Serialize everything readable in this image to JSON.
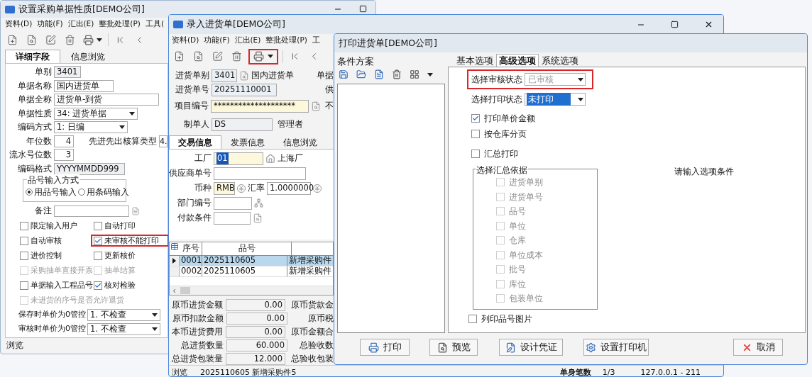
{
  "back_window": {
    "title": "设置采购单据性质[DEMO公司]",
    "menu": [
      "资料(D)",
      "功能(F)",
      "汇出(E)",
      "整批处理(P)",
      "工具("
    ],
    "tabs": [
      {
        "label": "详细字段",
        "selected": true
      },
      {
        "label": "信息浏览",
        "selected": false
      }
    ],
    "fields": [
      {
        "label": "单别",
        "value": "3401",
        "kind": "readonly"
      },
      {
        "label": "单据名称",
        "value": "国内进货单",
        "kind": "text"
      },
      {
        "label": "单据全称",
        "value": "进货单-到货",
        "kind": "text"
      },
      {
        "label": "单据性质",
        "value": "34: 进货单据",
        "kind": "select"
      },
      {
        "label": "编码方式",
        "value": "1: 日编",
        "kind": "select"
      },
      {
        "label": "年位数",
        "value": "4",
        "kind": "number",
        "side_label": "先进先出核算类型",
        "side_value": "4."
      },
      {
        "label": "流水号位数",
        "value": "3",
        "kind": "number"
      },
      {
        "label": "编码格式",
        "value": "YYYYMMDD999",
        "kind": "readonly"
      }
    ],
    "input_mode": {
      "title": "品号输入方式",
      "options": [
        {
          "label": "用品号输入",
          "selected": true
        },
        {
          "label": "用条码输入",
          "selected": false
        }
      ]
    },
    "remark": {
      "label": "备注"
    },
    "checkboxes": [
      {
        "label": "限定输入用户",
        "checked": false,
        "disabled": false,
        "highlighted": false
      },
      {
        "label": "自动打印",
        "checked": false,
        "disabled": false,
        "highlighted": false
      },
      {
        "label": "自动审核",
        "checked": false,
        "disabled": false,
        "highlighted": false
      },
      {
        "label": "未审核不能打印",
        "checked": true,
        "disabled": false,
        "highlighted": true
      },
      {
        "label": "进价控制",
        "checked": false,
        "disabled": false,
        "highlighted": false
      },
      {
        "label": "更新核价",
        "checked": false,
        "disabled": false,
        "highlighted": false
      },
      {
        "label": "采购抽单直接开票",
        "checked": false,
        "disabled": true,
        "highlighted": false
      },
      {
        "label": "抽单结算",
        "checked": false,
        "disabled": true,
        "highlighted": false
      },
      {
        "label": "单据输入工程品号",
        "checked": false,
        "disabled": false,
        "highlighted": false
      },
      {
        "label": "核对检验",
        "checked": true,
        "disabled": false,
        "highlighted": false
      },
      {
        "label": "未进货的序号是否允许退货",
        "checked": false,
        "disabled": true,
        "highlighted": false
      }
    ],
    "controls": [
      {
        "label": "保存时单价为0管控",
        "value": "1. 不检查"
      },
      {
        "label": "审核时单价为0管控",
        "value": "1. 不检查"
      }
    ],
    "status": "浏览"
  },
  "entry_window": {
    "title": "录入进货单[DEMO公司]",
    "menu": [
      "资料(D)",
      "功能(F)",
      "汇出(E)",
      "整批处理(P)",
      "工"
    ],
    "print_button": {
      "highlighted": true
    },
    "header": [
      {
        "label": "进货单别",
        "value": "3401",
        "kind": "code",
        "extra": "国内进货单",
        "right_label": "单据"
      },
      {
        "label": "进货单号",
        "value": "20251110001",
        "kind": "text",
        "right_label": "供"
      },
      {
        "label": "项目编号",
        "value": "********************",
        "kind": "masked",
        "right_label": "不"
      },
      {
        "label": "制单人",
        "value": "DS",
        "kind": "person",
        "extra": "管理者"
      }
    ],
    "tabs": [
      {
        "label": "交易信息",
        "selected": true
      },
      {
        "label": "发票信息",
        "selected": false
      },
      {
        "label": "信息浏览",
        "selected": false
      }
    ],
    "trade": [
      {
        "label": "工厂",
        "value": "01",
        "kind": "factory",
        "extra": "上海厂"
      },
      {
        "label": "供应商单号",
        "kind": "text"
      },
      {
        "label": "币种",
        "value": "RMB",
        "kind": "currency",
        "rate_label": "汇率",
        "rate": "1.0000000"
      },
      {
        "label": "部门编号",
        "kind": "department"
      },
      {
        "label": "付款条件",
        "kind": "terms"
      }
    ],
    "grid": {
      "columns": [
        "序号",
        "品号"
      ],
      "rows": [
        {
          "cells": [
            "0001",
            "2025110605",
            "新增采购件"
          ],
          "selected": true
        },
        {
          "cells": [
            "0002",
            "2025110605",
            "新增采购件"
          ],
          "selected": false
        }
      ]
    },
    "totals": [
      {
        "label": "原币进货金额",
        "value": "0.00",
        "right_label": "原币货款金"
      },
      {
        "label": "原币扣款金额",
        "value": "0.00",
        "right_label": "原币税"
      },
      {
        "label": "本币进货费用",
        "value": "0.00",
        "right_label": "原币金额合"
      },
      {
        "label": "总进货数量",
        "value": "60.000",
        "right_label": "总验收数"
      },
      {
        "label": "总进货包装量",
        "value": "12.000",
        "right_label": "总验收包装"
      }
    ],
    "status": {
      "mode": "浏览",
      "item": "2025110605 新增采购件5",
      "count_label": "单身笔数",
      "count": "1/3",
      "server": "127.0.0.1 - 211"
    }
  },
  "print_dialog": {
    "title": "打印进货单[DEMO公司]",
    "scheme_label": "条件方案",
    "tabs": [
      {
        "label": "基本选项",
        "selected": false
      },
      {
        "label": "高级选项",
        "selected": true
      },
      {
        "label": "系统选项",
        "selected": false
      }
    ],
    "selects": [
      {
        "label": "选择审核状态",
        "value": "已审核",
        "disabled": true,
        "focused": false,
        "highlighted": true
      },
      {
        "label": "选择打印状态",
        "value": "未打印",
        "disabled": false,
        "focused": true,
        "highlighted": false
      }
    ],
    "options": [
      {
        "label": "打印单价金额",
        "checked": true
      },
      {
        "label": "按仓库分页",
        "checked": false
      },
      {
        "label": "汇总打印",
        "checked": false
      }
    ],
    "summary_group": {
      "title": "选择汇总依据",
      "items": [
        {
          "label": "进货单别",
          "checked": false
        },
        {
          "label": "进货单号",
          "checked": false
        },
        {
          "label": "品号",
          "checked": false
        },
        {
          "label": "单位",
          "checked": false
        },
        {
          "label": "仓库",
          "checked": false
        },
        {
          "label": "单位成本",
          "checked": false
        },
        {
          "label": "批号",
          "checked": false
        },
        {
          "label": "库位",
          "checked": false
        },
        {
          "label": "包装单位",
          "checked": false
        }
      ]
    },
    "picture_option": {
      "label": "列印品号图片",
      "checked": false
    },
    "hint": "请输入选项条件",
    "buttons": [
      {
        "label": "打印",
        "kind": "print"
      },
      {
        "label": "预览",
        "kind": "preview"
      },
      {
        "label": "设计凭证",
        "kind": "design"
      },
      {
        "label": "设置打印机",
        "kind": "printer"
      },
      {
        "label": "取消",
        "kind": "cancel"
      }
    ]
  }
}
